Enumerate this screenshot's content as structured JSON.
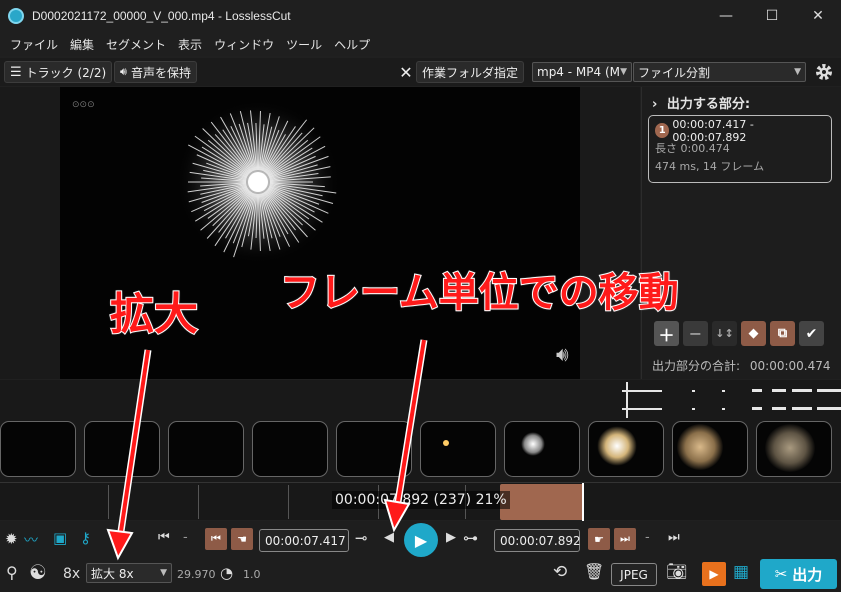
{
  "window": {
    "title": "D0002021172_00000_V_000.mp4 - LosslessCut",
    "minimize": "—",
    "maximize": "☐",
    "close": "✕"
  },
  "menu": [
    "ファイル",
    "編集",
    "セグメント",
    "表示",
    "ウィンドウ",
    "ツール",
    "ヘルプ"
  ],
  "toolbar": {
    "tracks_label": "トラック (2/2)",
    "keep_audio_label": "音声を保持",
    "close_symbol": "✕",
    "workdir_label": "作業フォルダ指定",
    "format_value": "mp4 - MP4 (M",
    "split_mode_value": "ファイル分割"
  },
  "panel": {
    "heading": "出力する部分:",
    "segment": {
      "number": "1",
      "range": "00:00:07.417 - 00:00:07.892",
      "duration": "長さ 0:00.474",
      "detail": "474 ms, 14 フレーム"
    },
    "total_label": "出力部分の合計:",
    "total_value": "00:00:00.474"
  },
  "timeline": {
    "cursor_text": "00:00:07.892 (237) 21%"
  },
  "controls": {
    "start_time": "00:00:07.417",
    "end_time": "00:00:07.892",
    "dash": "-",
    "zoom_prefix": "8x",
    "zoom_value": "拡大 8x",
    "fps": "29.970",
    "speed": "1.0",
    "capture_format": "JPEG",
    "export_label": "出力"
  },
  "annotations": {
    "zoom_note": "拡大",
    "frame_note": "フレーム単位での移動"
  },
  "colors": {
    "accent": "#1fa8c9",
    "segment": "#a0674f",
    "annotation": "#ff1a1a"
  }
}
